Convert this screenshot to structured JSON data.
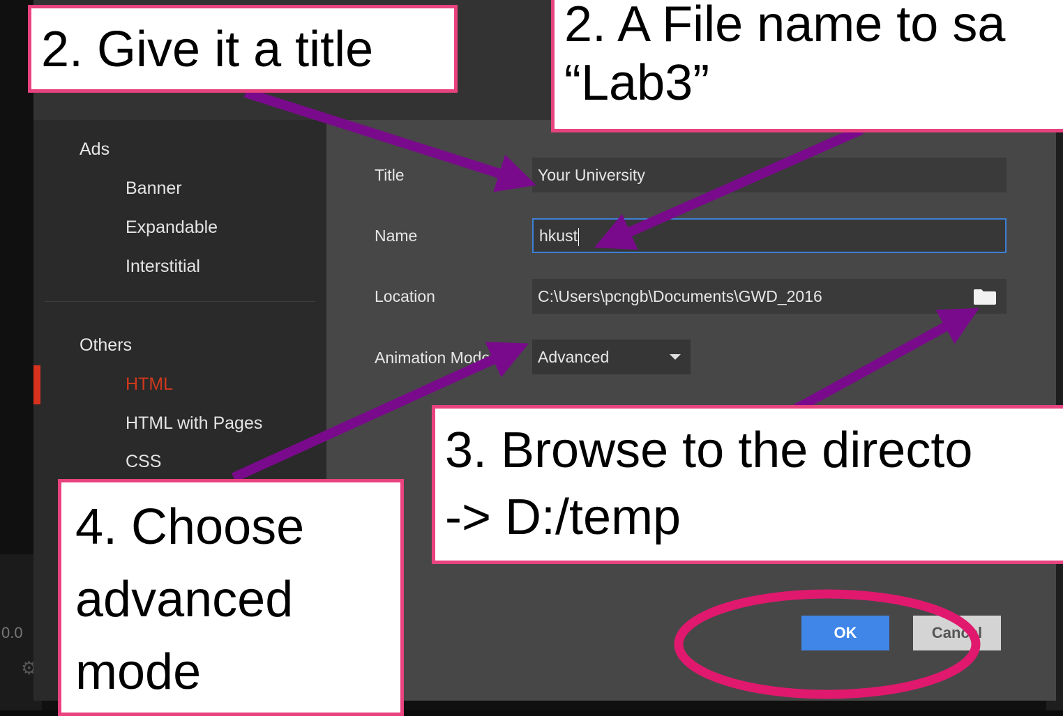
{
  "sidebar": {
    "ads_heading": "Ads",
    "ads_items": [
      "Banner",
      "Expandable",
      "Interstitial"
    ],
    "others_heading": "Others",
    "others_items": [
      "HTML",
      "HTML with Pages",
      "CSS"
    ],
    "active_item": "HTML"
  },
  "form": {
    "title_label": "Title",
    "title_value": "Your University",
    "name_label": "Name",
    "name_value": "hkust",
    "location_label": "Location",
    "location_value": "C:\\Users\\pcngb\\Documents\\GWD_2016",
    "animation_label": "Animation Mode",
    "animation_value": "Advanced"
  },
  "buttons": {
    "ok_label": "OK",
    "cancel_label": "Cancel"
  },
  "background": {
    "timeline_readout": "0.0"
  },
  "annotations": {
    "title_callout": "2. Give it a title",
    "name_callout_line1": "2. A File name to sa",
    "name_callout_line2": "“Lab3”",
    "browse_callout_line1": "3. Browse to the directo",
    "browse_callout_line2": "-> D:/temp",
    "mode_callout_line1": "4. Choose",
    "mode_callout_line2": "advanced",
    "mode_callout_line3": "mode"
  },
  "colors": {
    "arrow": "#7a0a8c",
    "callout_border": "#e8437f",
    "highlight_ellipse": "#e0196e",
    "active_item": "#d0381c",
    "ok_button": "#3f86e8"
  }
}
